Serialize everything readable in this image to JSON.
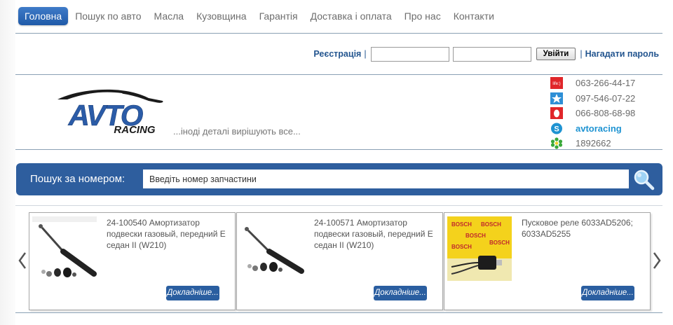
{
  "nav": {
    "items": [
      {
        "label": "Головна",
        "active": true
      },
      {
        "label": "Пошук по авто"
      },
      {
        "label": "Масла"
      },
      {
        "label": "Кузовщина"
      },
      {
        "label": "Гарантія"
      },
      {
        "label": "Доставка і оплата"
      },
      {
        "label": "Про нас"
      },
      {
        "label": "Контакти"
      }
    ]
  },
  "login": {
    "register_label": "Реєстрація",
    "separator": "|",
    "login_value": "",
    "password_value": "",
    "submit_label": "Увійти",
    "remind_label": "Нагадати пароль"
  },
  "brand": {
    "logo_text_top": "AVTO",
    "logo_text_bottom": "RACING",
    "tagline": "...іноді деталі вирішують все..."
  },
  "contacts": [
    {
      "icon": "life-icon",
      "icon_text": "life:)",
      "text": "063-266-44-17"
    },
    {
      "icon": "kyivstar-icon",
      "text": "097-546-07-22"
    },
    {
      "icon": "mts-icon",
      "text": "066-808-68-98"
    },
    {
      "icon": "skype-icon",
      "text": "avtoracing"
    },
    {
      "icon": "icq-icon",
      "text": "1892662"
    }
  ],
  "search": {
    "label": "Пошук за номером:",
    "placeholder": "Введіть номер запчастини"
  },
  "products": [
    {
      "title": "24-100540 Амортизатор подвески газовый, передний E седан II (W210)",
      "button": "Докладніше...",
      "image": "shock-absorber"
    },
    {
      "title": "24-100571 Амортизатор подвески газовый, передний E седан II (W210)",
      "button": "Докладніше...",
      "image": "shock-absorber"
    },
    {
      "title": "Пусковое реле 6033AD5206; 6033AD5255",
      "button": "Докладніше...",
      "image": "bosch-relay",
      "image_text": "BOSCH"
    }
  ],
  "colors": {
    "accent": "#2e5e9e",
    "link": "#23558f",
    "skype": "#1e93d2"
  }
}
